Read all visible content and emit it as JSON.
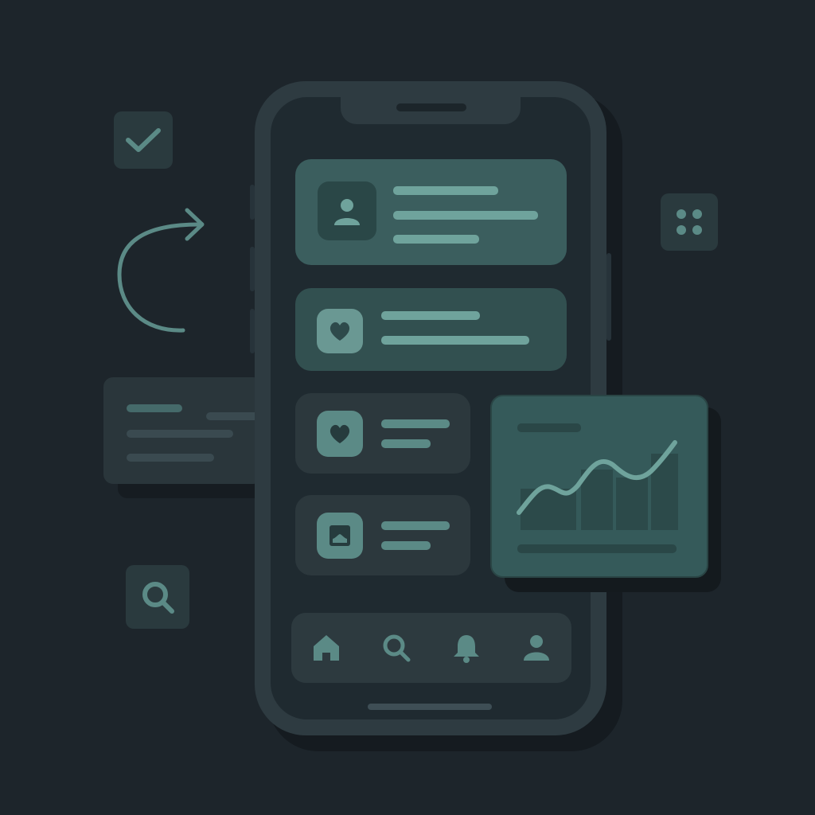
{
  "colors": {
    "background": "#1d252b",
    "phone_frame": "#2e3b41",
    "screen": "#1f2a30",
    "accent_teal": "#3b5e5e",
    "accent_light": "#6fa39c",
    "icon_muted": "#5b8a86"
  },
  "floating_icons": [
    "check-icon",
    "redo-arrow-icon",
    "grid-icon",
    "search-icon"
  ],
  "phone": {
    "cards": [
      {
        "icon": "user-icon",
        "lines": 3
      },
      {
        "icon": "heart-icon",
        "lines": 2
      },
      {
        "icon": "heart-icon",
        "lines": 2
      },
      {
        "icon": "image-icon",
        "lines": 2
      }
    ],
    "bottom_nav": [
      "home-icon",
      "search-icon",
      "bell-icon",
      "user-icon"
    ]
  },
  "chart_card": {
    "icon": "line-chart-icon"
  }
}
